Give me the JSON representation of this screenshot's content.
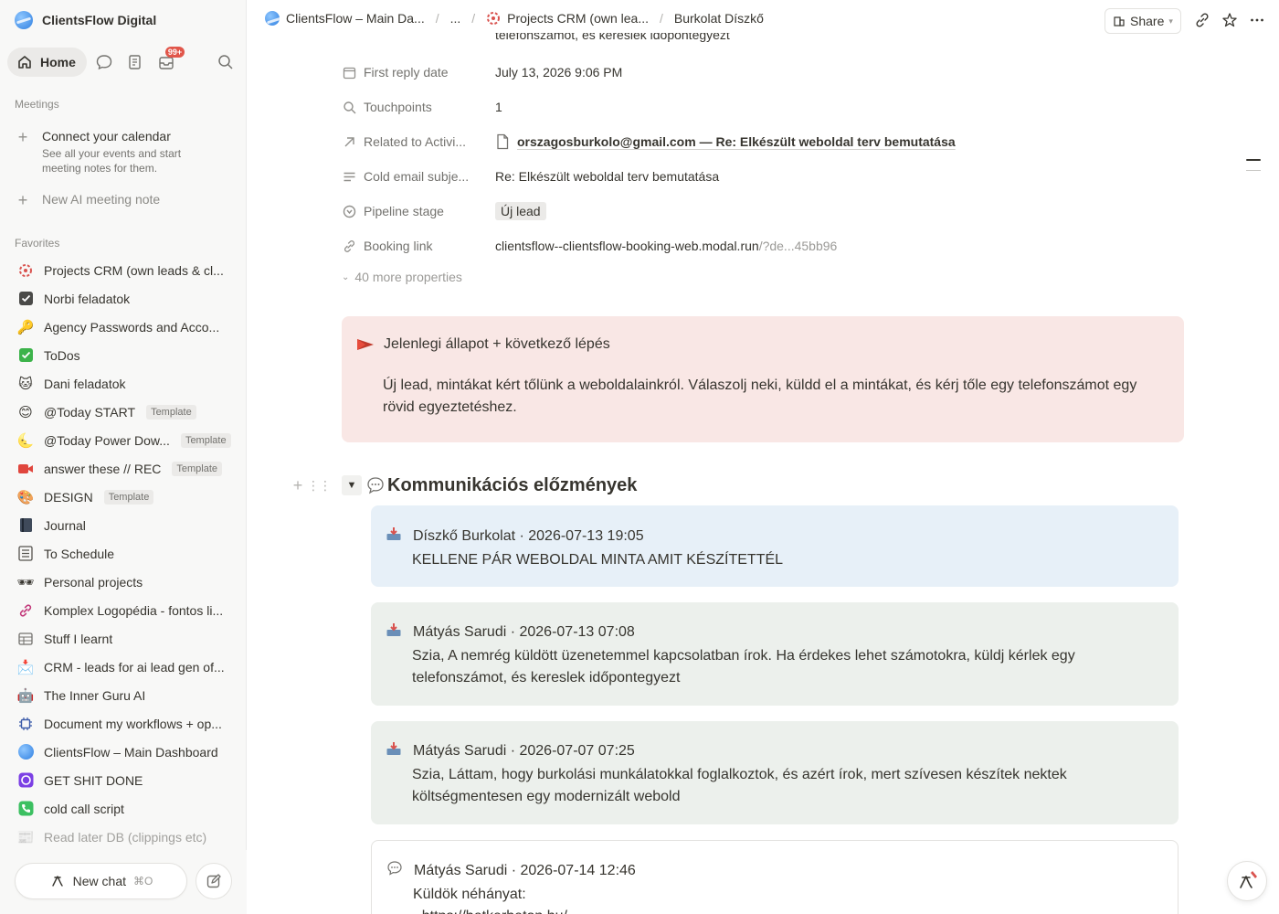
{
  "workspace": {
    "name": "ClientsFlow Digital"
  },
  "nav": {
    "home_label": "Home",
    "inbox_badge": "99+"
  },
  "meetings": {
    "label": "Meetings",
    "connect_title": "Connect your calendar",
    "connect_desc": "See all your events and start meeting notes for them.",
    "new_ai_note": "New AI meeting note"
  },
  "favorites": {
    "label": "Favorites",
    "items": [
      {
        "label": "Projects CRM (own leads & cl...",
        "icon": "crm-icon"
      },
      {
        "label": "Norbi feladatok",
        "icon": "checkbox-icon"
      },
      {
        "label": "Agency Passwords and Acco...",
        "icon": "key-icon"
      },
      {
        "label": "ToDos",
        "icon": "check-mark-icon"
      },
      {
        "label": "Dani feladatok",
        "icon": "cat-icon"
      },
      {
        "label": "@Today START",
        "icon": "smile-icon",
        "badge": "Template"
      },
      {
        "label": "@Today Power Dow...",
        "icon": "moon-icon",
        "badge": "Template"
      },
      {
        "label": "answer these // REC",
        "icon": "video-camera-icon",
        "badge": "Template"
      },
      {
        "label": "DESIGN",
        "icon": "palette-icon",
        "badge": "Template"
      },
      {
        "label": "Journal",
        "icon": "notebook-icon"
      },
      {
        "label": "To Schedule",
        "icon": "list-icon"
      },
      {
        "label": "Personal projects",
        "icon": "sunglasses-icon"
      },
      {
        "label": "Komplex Logopédia - fontos li...",
        "icon": "link-icon"
      },
      {
        "label": "Stuff I learnt",
        "icon": "table-icon"
      },
      {
        "label": "CRM - leads for ai lead gen of...",
        "icon": "envelope-icon"
      },
      {
        "label": "The Inner Guru AI",
        "icon": "robot-icon"
      },
      {
        "label": "Document my workflows + op...",
        "icon": "chip-icon"
      },
      {
        "label": "ClientsFlow – Main Dashboard",
        "icon": "globe-icon"
      },
      {
        "label": "GET SHIT DONE",
        "icon": "purple-app-icon"
      },
      {
        "label": "cold call script",
        "icon": "phone-icon"
      },
      {
        "label": "Read later DB (clippings etc)",
        "icon": "newspaper-icon"
      }
    ]
  },
  "bottom": {
    "new_chat": "New chat",
    "shortcut": "⌘O"
  },
  "breadcrumb": {
    "items": [
      "ClientsFlow – Main Da...",
      "...",
      "Projects CRM (own lea...",
      "Burkolat Díszkő"
    ]
  },
  "topbar": {
    "share_label": "Share"
  },
  "properties": {
    "clipped_above": "telefonszámot, és kereslek időpontegyezt",
    "rows": [
      {
        "name": "First reply date",
        "value": "July 13, 2026 9:06 PM"
      },
      {
        "name": "Touchpoints",
        "value": "1"
      },
      {
        "name": "Related to Activi...",
        "value": "orszagosburkolo@gmail.com — Re: Elkészült weboldal terv bemutatása"
      },
      {
        "name": "Cold email subje...",
        "value": "Re: Elkészült weboldal terv bemutatása"
      },
      {
        "name": "Pipeline stage",
        "value": "Új lead"
      },
      {
        "name": "Booking link",
        "value": "clientsflow--clientsflow-booking-web.modal.run",
        "value_dim": "/?de...45bb96"
      }
    ],
    "more": "40 more properties"
  },
  "callout": {
    "title": "Jelenlegi állapot + következő lépés",
    "body": "Új lead, mintákat kért tőlünk a weboldalainkról. Válaszolj neki, küldd el a mintákat, és kérj tőle egy telefonszámot egy rövid egyeztetéshez."
  },
  "communication": {
    "title": "Kommunikációs előzmények",
    "messages": [
      {
        "header": "Díszkő Burkolat · 2026-07-13 19:05",
        "body": "KELLENE PÁR WEBOLDAL MINTA AMIT KÉSZÍTETTÉL"
      },
      {
        "header": "Mátyás Sarudi · 2026-07-13 07:08",
        "body": "Szia, A nemrég küldött üzenetemmel kapcsolatban írok. Ha érdekes lehet számotokra, küldj kérlek egy telefonszámot, és kereslek időpontegyezt"
      },
      {
        "header": "Mátyás Sarudi · 2026-07-07 07:25",
        "body": "Szia, Láttam, hogy burkolási munkálatokkal foglalkoztok, és azért írok, mert szívesen készítek nektek költségmentesen egy modernizált webold"
      },
      {
        "header": "Mátyás Sarudi · 2026-07-14 12:46",
        "body": "Küldök néhányat:",
        "body2": "- https://betkerbeton.hu/"
      }
    ]
  },
  "colors": {
    "callout_bg": "#f9e7e5",
    "msg_blue": "#e7f0f8",
    "msg_green": "#ecf0ec"
  }
}
